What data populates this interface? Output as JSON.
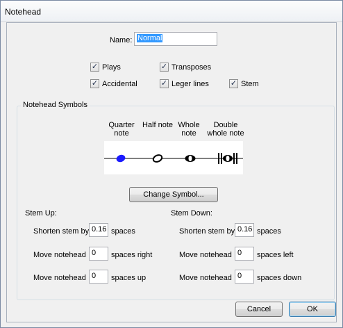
{
  "window": {
    "title": "Notehead"
  },
  "name_field": {
    "label": "Name:",
    "value": "Normal"
  },
  "checkboxes": {
    "plays": {
      "label": "Plays",
      "checked": true
    },
    "transposes": {
      "label": "Transposes",
      "checked": true
    },
    "accidental": {
      "label": "Accidental",
      "checked": true
    },
    "leger_lines": {
      "label": "Leger lines",
      "checked": true
    },
    "stem": {
      "label": "Stem",
      "checked": true
    },
    "check_glyph": "✓"
  },
  "symbols": {
    "group_label": "Notehead Symbols",
    "columns": [
      {
        "line1": "Quarter",
        "line2": "note"
      },
      {
        "line1": "Half note",
        "line2": ""
      },
      {
        "line1": "Whole",
        "line2": "note"
      },
      {
        "line1": "Double",
        "line2": "whole note"
      }
    ],
    "selected_color": "#1a1aff",
    "change_button": "Change Symbol..."
  },
  "stem_up": {
    "heading": "Stem Up:",
    "shorten": {
      "label": "Shorten stem by",
      "value": "0.16",
      "unit": "spaces"
    },
    "move_h": {
      "label": "Move notehead",
      "value": "0",
      "unit": "spaces right"
    },
    "move_v": {
      "label": "Move notehead",
      "value": "0",
      "unit": "spaces up"
    }
  },
  "stem_down": {
    "heading": "Stem Down:",
    "shorten": {
      "label": "Shorten stem by",
      "value": "0.16",
      "unit": "spaces"
    },
    "move_h": {
      "label": "Move notehead",
      "value": "0",
      "unit": "spaces left"
    },
    "move_v": {
      "label": "Move notehead",
      "value": "0",
      "unit": "spaces down"
    }
  },
  "buttons": {
    "cancel": "Cancel",
    "ok": "OK"
  }
}
